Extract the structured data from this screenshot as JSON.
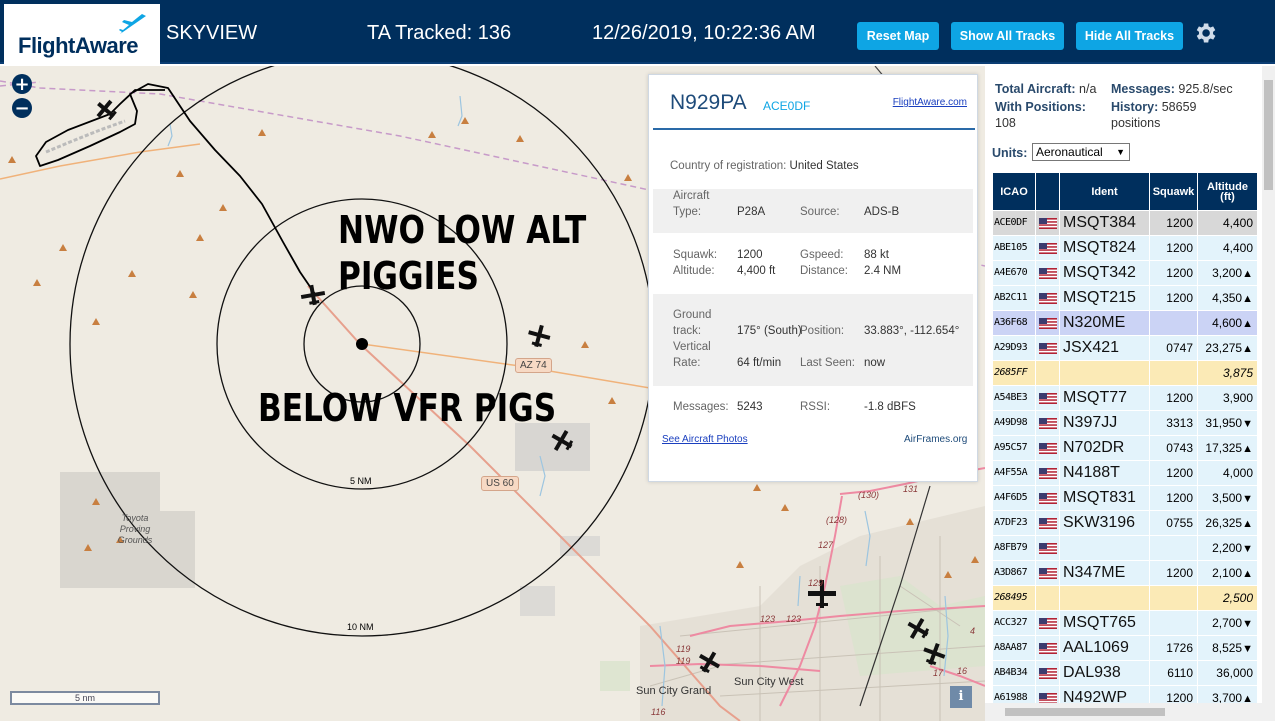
{
  "header": {
    "logo": "FlightAware",
    "app_name": "SKYVIEW",
    "tracked": "TA Tracked: 136",
    "datetime": "12/26/2019, 10:22:36 AM",
    "buttons": {
      "reset_map": "Reset Map",
      "show_all": "Show All Tracks",
      "hide_all": "Hide All Tracks"
    },
    "settings_icon": "gear-icon"
  },
  "map": {
    "zoom_in": "+",
    "zoom_out": "−",
    "overlay_text_1a": "NWO LOW ALT",
    "overlay_text_1b": "PIGGIES",
    "overlay_text_2": "BELOW VFR PIGS",
    "ring_labels": {
      "r5": "5 NM",
      "r10": "10 NM"
    },
    "road_labels": {
      "az74": "AZ 74",
      "us60": "US 60"
    },
    "places": {
      "toyota": "Toyota Proving Grounds",
      "sun_city_grand": "Sun City Grand",
      "sun_city_west": "Sun City West"
    },
    "route_numbers": [
      "(130)",
      "131",
      "(128)",
      "127",
      "123",
      "123",
      "119",
      "119",
      "116",
      "17",
      "16",
      "129",
      "4"
    ],
    "scale": "5 nm",
    "info_button": "i"
  },
  "popup": {
    "title": "N929PA",
    "icao": "ACE0DF",
    "flightaware_link": "FlightAware.com",
    "country_label": "Country of registration:",
    "country_value": "United States",
    "aircraft_type_label_1": "Aircraft",
    "aircraft_type_label_2": "Type:",
    "aircraft_type_value": "P28A",
    "source_label": "Source:",
    "source_value": "ADS-B",
    "squawk_label": "Squawk:",
    "squawk_value": "1200",
    "gspeed_label": "Gspeed:",
    "gspeed_value": "88 kt",
    "altitude_label": "Altitude:",
    "altitude_value": "4,400 ft",
    "distance_label": "Distance:",
    "distance_value": "2.4 NM",
    "ground_label_1": "Ground",
    "ground_label_2": "track:",
    "ground_value": "175° (South)",
    "position_label": "Position:",
    "position_value": "33.883°, -112.654°",
    "vrate_label_1": "Vertical",
    "vrate_label_2": "Rate:",
    "vrate_value": "64 ft/min",
    "lastseen_label": "Last Seen:",
    "lastseen_value": "now",
    "messages_label": "Messages:",
    "messages_value": "5243",
    "rssi_label": "RSSI:",
    "rssi_value": "-1.8 dBFS",
    "photos_link": "See Aircraft Photos",
    "airframes_link": "AirFrames.org"
  },
  "sidebar": {
    "total_label": "Total Aircraft:",
    "total_value": "n/a",
    "messages_label": "Messages:",
    "messages_value": "925.8/sec",
    "withpos_label": "With Positions:",
    "withpos_value": "108",
    "history_label": "History:",
    "history_value": "58659",
    "history_unit": "positions",
    "units_label": "Units:",
    "units_value": "Aeronautical",
    "columns": {
      "icao": "ICAO",
      "ident": "Ident",
      "squawk": "Squawk",
      "alt1": "Altitude",
      "alt2": "(ft)"
    },
    "rows": [
      {
        "icao": "ACE0DF",
        "flag": true,
        "ident": "MSQT384",
        "squawk": "1200",
        "alt": "4,400",
        "trend": "",
        "style": "selected"
      },
      {
        "icao": "ABE105",
        "flag": true,
        "ident": "MSQT824",
        "squawk": "1200",
        "alt": "4,400",
        "trend": "",
        "style": "normal"
      },
      {
        "icao": "A4E670",
        "flag": true,
        "ident": "MSQT342",
        "squawk": "1200",
        "alt": "3,200",
        "trend": "▲",
        "style": "normal"
      },
      {
        "icao": "AB2C11",
        "flag": true,
        "ident": "MSQT215",
        "squawk": "1200",
        "alt": "4,350",
        "trend": "▲",
        "style": "normal"
      },
      {
        "icao": "A36F68",
        "flag": true,
        "ident": "N320ME",
        "squawk": "",
        "alt": "4,600",
        "trend": "▲",
        "style": "highlight"
      },
      {
        "icao": "A29D93",
        "flag": true,
        "ident": "JSX421",
        "squawk": "0747",
        "alt": "23,275",
        "trend": "▲",
        "style": "normal"
      },
      {
        "icao": "2685FF",
        "flag": false,
        "ident": "",
        "squawk": "",
        "alt": "3,875",
        "trend": "",
        "style": "yellow"
      },
      {
        "icao": "A54BE3",
        "flag": true,
        "ident": "MSQT77",
        "squawk": "1200",
        "alt": "3,900",
        "trend": "",
        "style": "normal"
      },
      {
        "icao": "A49D98",
        "flag": true,
        "ident": "N397JJ",
        "squawk": "3313",
        "alt": "31,950",
        "trend": "▼",
        "style": "normal"
      },
      {
        "icao": "A95C57",
        "flag": true,
        "ident": "N702DR",
        "squawk": "0743",
        "alt": "17,325",
        "trend": "▲",
        "style": "normal"
      },
      {
        "icao": "A4F55A",
        "flag": true,
        "ident": "N4188T",
        "squawk": "1200",
        "alt": "4,000",
        "trend": "",
        "style": "normal"
      },
      {
        "icao": "A4F6D5",
        "flag": true,
        "ident": "MSQT831",
        "squawk": "1200",
        "alt": "3,500",
        "trend": "▼",
        "style": "normal"
      },
      {
        "icao": "A7DF23",
        "flag": true,
        "ident": "SKW3196",
        "squawk": "0755",
        "alt": "26,325",
        "trend": "▲",
        "style": "normal"
      },
      {
        "icao": "A8FB79",
        "flag": true,
        "ident": "",
        "squawk": "",
        "alt": "2,200",
        "trend": "▼",
        "style": "normal"
      },
      {
        "icao": "A3D867",
        "flag": true,
        "ident": "N347ME",
        "squawk": "1200",
        "alt": "2,100",
        "trend": "▲",
        "style": "normal"
      },
      {
        "icao": "268495",
        "flag": false,
        "ident": "",
        "squawk": "",
        "alt": "2,500",
        "trend": "",
        "style": "yellow"
      },
      {
        "icao": "ACC327",
        "flag": true,
        "ident": "MSQT765",
        "squawk": "",
        "alt": "2,700",
        "trend": "▼",
        "style": "normal"
      },
      {
        "icao": "A8AA87",
        "flag": true,
        "ident": "AAL1069",
        "squawk": "1726",
        "alt": "8,525",
        "trend": "▼",
        "style": "normal"
      },
      {
        "icao": "AB4B34",
        "flag": true,
        "ident": "DAL938",
        "squawk": "6110",
        "alt": "36,000",
        "trend": "",
        "style": "normal"
      },
      {
        "icao": "A61988",
        "flag": true,
        "ident": "N492WP",
        "squawk": "1200",
        "alt": "3,700",
        "trend": "▲",
        "style": "normal"
      }
    ]
  },
  "colors": {
    "header_bg": "#002f5d",
    "button_bg": "#0ea5e4",
    "row_normal": "#e3f3fb",
    "row_selected": "#d8d8d8",
    "row_highlight": "#cbd3f5",
    "row_yellow": "#fbeab6",
    "map_bg": "#efebe2"
  }
}
